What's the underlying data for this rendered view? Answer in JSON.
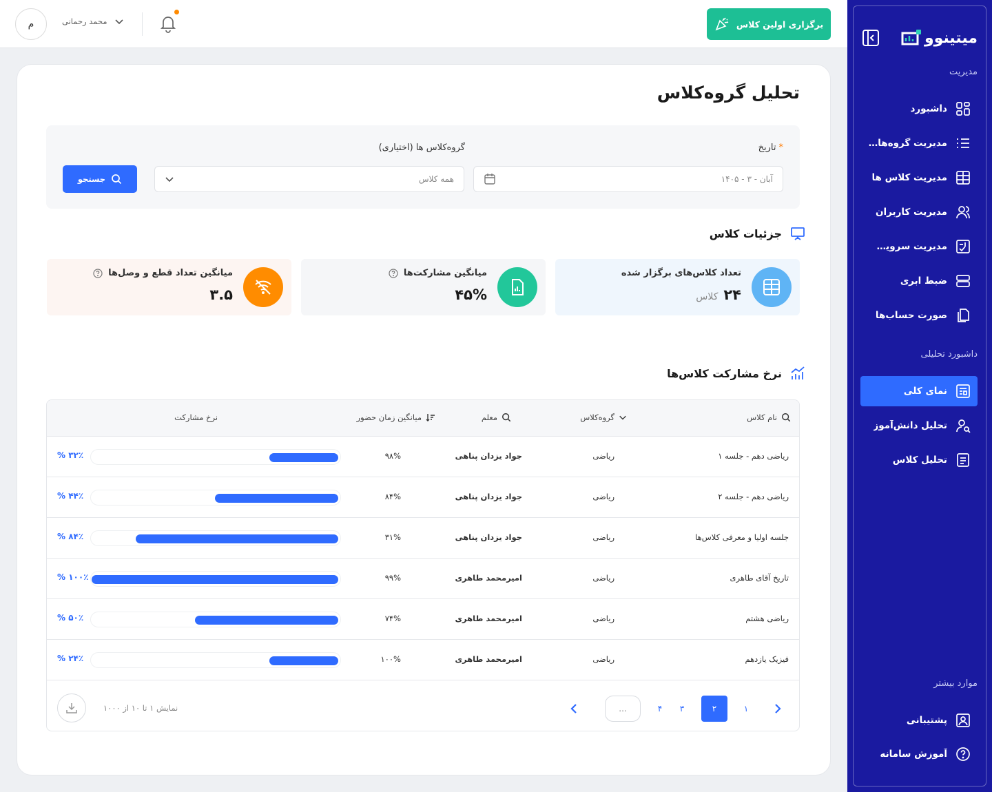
{
  "sidebar": {
    "brand": "میتینوو",
    "sections": {
      "management": "مدیریت",
      "analytics": "داشبورد تحلیلی",
      "more": "موارد بیشتر"
    },
    "items": [
      {
        "label": "داشبورد",
        "icon": "dashboard-icon"
      },
      {
        "label": "مدیریت گروه‌های کلاس",
        "icon": "list-icon"
      },
      {
        "label": "مدیریت کلاس ها",
        "icon": "grid-table-icon"
      },
      {
        "label": "مدیریت کاربران",
        "icon": "users-icon"
      },
      {
        "label": "مدیریت سرویس‌ها",
        "icon": "services-icon"
      },
      {
        "label": "ضبط ابری",
        "icon": "server-icon"
      },
      {
        "label": "صورت حساب‌ها",
        "icon": "documents-icon"
      },
      {
        "label": "نمای کلی",
        "icon": "overview-icon",
        "active": true
      },
      {
        "label": "تحلیل دانش‌آموز",
        "icon": "user-search-icon"
      },
      {
        "label": "تحلیل کلاس",
        "icon": "report-icon"
      },
      {
        "label": "پشتیبانی",
        "icon": "support-icon"
      },
      {
        "label": "آموزش سامانه",
        "icon": "help-icon"
      }
    ]
  },
  "topbar": {
    "cta_label": "برگزاری اولین کلاس",
    "user_name": "محمد رحمانی",
    "avatar_initial": "م"
  },
  "page": {
    "title": "تحلیل گروه‌کلاس",
    "filters": {
      "date_label": "تاریخ",
      "date_value": "آبان - ۳ - ۱۴۰۵",
      "group_label": "گروه‌کلاس ها (اختیاری)",
      "group_value": "همه کلاس",
      "search_label": "جستجو"
    },
    "details_title": "جزئیات کلاس",
    "stats": [
      {
        "label": "تعداد کلاس‌های برگزار شده",
        "value": "۲۴",
        "unit": "کلاس",
        "color": "#5fb4f5"
      },
      {
        "label": "میانگین مشارکت‌ها",
        "value": "۴۵%",
        "unit": "",
        "color": "#22c79a"
      },
      {
        "label": "میانگین تعداد قطع و وصل‌ها",
        "value": "۳.۵",
        "unit": "",
        "color": "#ff8c00"
      }
    ],
    "rates_title": "نرخ مشارکت کلاس‌ها"
  },
  "table": {
    "headers": {
      "name": "نام کلاس",
      "group": "گروه‌کلاس",
      "teacher": "معلم",
      "avg_time": "میانگین زمان حضور",
      "rate": "نرخ مشارکت"
    },
    "rows": [
      {
        "name": "ریاضی دهم - جلسه ۱",
        "group": "ریاضی",
        "teacher": "جواد یزدان پناهی",
        "avg_time": "۹۸%",
        "rate_label": "۳۲٪ %",
        "rate": 0.28
      },
      {
        "name": "ریاضی دهم - جلسه ۲",
        "group": "ریاضی",
        "teacher": "جواد یزدان پناهی",
        "avg_time": "۸۴%",
        "rate_label": "۴۴٪ %",
        "rate": 0.5
      },
      {
        "name": "جلسه اولیا و معرفی کلاس‌ها",
        "group": "ریاضی",
        "teacher": "جواد یزدان پناهی",
        "avg_time": "۳۱%",
        "rate_label": "۸۴٪ %",
        "rate": 0.82
      },
      {
        "name": "تاریخ آقای طاهری",
        "group": "ریاضی",
        "teacher": "امیرمحمد طاهری",
        "avg_time": "۹۹%",
        "rate_label": "۱۰۰٪ %",
        "rate": 1.0
      },
      {
        "name": "ریاضی هشتم",
        "group": "ریاضی",
        "teacher": "امیرمحمد طاهری",
        "avg_time": "۷۴%",
        "rate_label": "۵۰٪ %",
        "rate": 0.58
      },
      {
        "name": "فیزیک یازدهم",
        "group": "ریاضی",
        "teacher": "امیرمحمد طاهری",
        "avg_time": "۱۰۰%",
        "rate_label": "۲۴٪ %",
        "rate": 0.28
      }
    ],
    "pagination": {
      "pages": [
        "۱",
        "۲",
        "۳",
        "۴",
        "..."
      ],
      "active_page": "۲",
      "info": "نمایش ۱ تا ۱۰ از ۱۰۰۰"
    }
  }
}
